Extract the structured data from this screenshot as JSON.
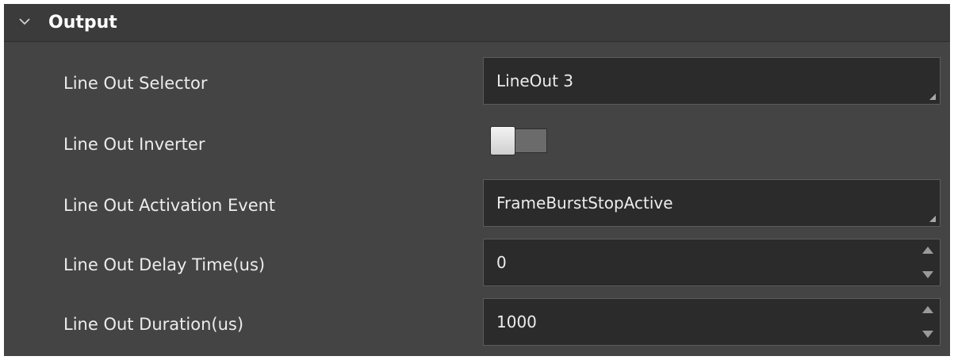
{
  "section": {
    "title": "Output",
    "expanded": true,
    "chevron_icon": "chevron-down-icon"
  },
  "rows": [
    {
      "label": "Line Out Selector",
      "control": "dropdown",
      "value": "LineOut 3"
    },
    {
      "label": "Line Out Inverter",
      "control": "toggle",
      "checked": false
    },
    {
      "label": "Line Out Activation Event",
      "control": "dropdown",
      "value": "FrameBurstStopActive"
    },
    {
      "label": "Line Out Delay Time(us)",
      "control": "spinbox",
      "value": "0"
    },
    {
      "label": "Line Out Duration(us)",
      "control": "spinbox",
      "value": "1000"
    }
  ],
  "colors": {
    "panel_background": "#444444",
    "header_background": "#3b3b3b",
    "field_background": "#2b2b2b",
    "text": "#ececec"
  }
}
